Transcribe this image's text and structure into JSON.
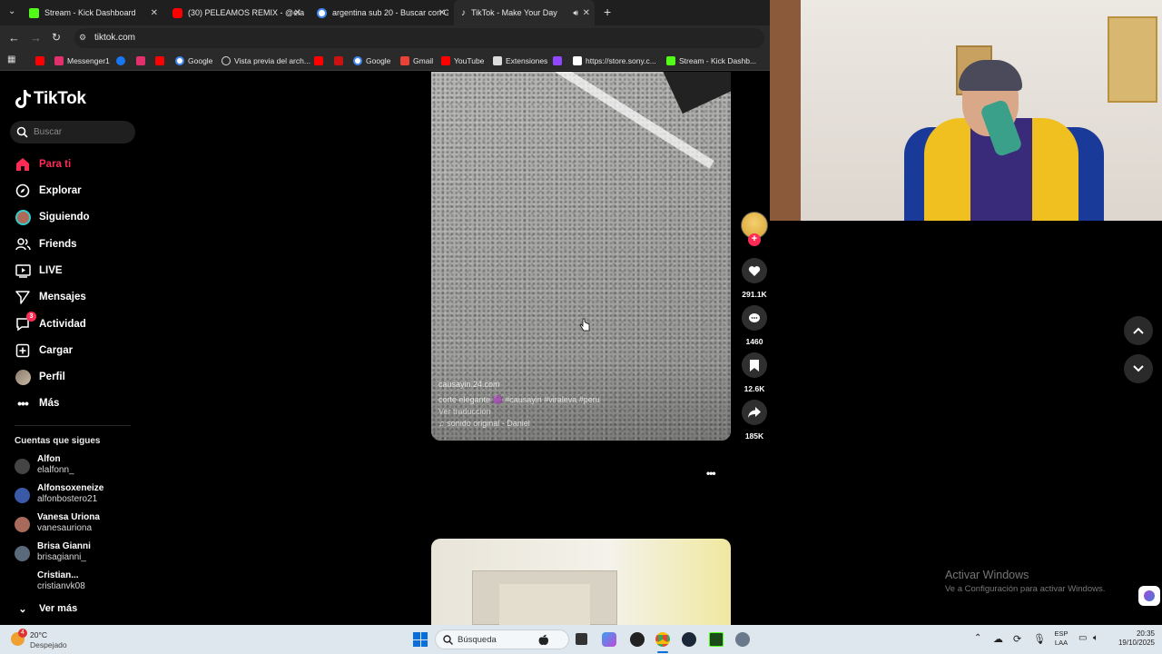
{
  "browser": {
    "tabs": [
      {
        "label": "Stream - Kick Dashboard",
        "favicon_color": "#53fc18"
      },
      {
        "label": "(30) PELEAMOS REMIX - @elag",
        "favicon_color": "#ff0000"
      },
      {
        "label": "argentina sub 20 - Buscar con G",
        "favicon_color": "#4285f4"
      },
      {
        "label": "TikTok - Make Your Day",
        "favicon_color": "#ffffff"
      }
    ],
    "url": "tiktok.com",
    "bookmarks": [
      {
        "label": "Messenger1",
        "color": "#e1306c"
      },
      {
        "label": "",
        "color": "#1877f2"
      },
      {
        "label": "",
        "color": "#e1306c"
      },
      {
        "label": "",
        "color": "#ff0000"
      },
      {
        "label": "Google",
        "color": "#4285f4"
      },
      {
        "label": "Vista previa del arch...",
        "color": "#ffffff"
      },
      {
        "label": "",
        "color": "#ff0000"
      },
      {
        "label": "",
        "color": "#d11"
      },
      {
        "label": "Google",
        "color": "#4285f4"
      },
      {
        "label": "Gmail",
        "color": "#ea4335"
      },
      {
        "label": "YouTube",
        "color": "#ff0000"
      },
      {
        "label": "Extensiones",
        "color": "#ffffff"
      },
      {
        "label": "",
        "color": "#9146ff"
      },
      {
        "label": "https://store.sony.c...",
        "color": "#ffffff"
      },
      {
        "label": "Stream - Kick Dashb...",
        "color": "#53fc18"
      }
    ]
  },
  "tiktok": {
    "logo": "TikTok",
    "search_placeholder": "Buscar",
    "nav": [
      {
        "label": "Para ti",
        "icon": "home-icon",
        "active": true
      },
      {
        "label": "Explorar",
        "icon": "compass-icon"
      },
      {
        "label": "Siguiendo",
        "icon": "following-avatar-icon"
      },
      {
        "label": "Friends",
        "icon": "friends-icon"
      },
      {
        "label": "LIVE",
        "icon": "live-icon"
      },
      {
        "label": "Mensajes",
        "icon": "messages-icon"
      },
      {
        "label": "Actividad",
        "icon": "activity-icon",
        "badge": "3"
      },
      {
        "label": "Cargar",
        "icon": "upload-icon"
      },
      {
        "label": "Perfil",
        "icon": "profile-avatar-icon"
      },
      {
        "label": "Más",
        "icon": "more-icon"
      }
    ],
    "following_heading": "Cuentas que sigues",
    "accounts": [
      {
        "name": "Alfon",
        "handle": "elalfonn_",
        "color": "#444"
      },
      {
        "name": "Alfonsoxeneize",
        "handle": "alfonbostero21",
        "color": "#3a5aa8"
      },
      {
        "name": "Vanesa Uriona",
        "handle": "vanesauriona",
        "color": "#a86a5a"
      },
      {
        "name": "Brisa Gianni",
        "handle": "brisagianni_",
        "color": "#5a6a7a"
      },
      {
        "name": "Cristian...",
        "handle": "cristianvk08",
        "color": "#000000"
      }
    ],
    "see_more": "Ver más",
    "video": {
      "watermark": "causayin.24.com",
      "caption": "corte elegante 🟣 #causayin #viraleva #peru",
      "translation": "Ver traducción",
      "sound": "♫ sonido original - Daniel"
    },
    "actions": {
      "likes": "291.1K",
      "comments": "1460",
      "saves": "12.6K",
      "shares": "185K"
    },
    "accent": "#fe2c55"
  },
  "windows": {
    "activate_title": "Activar Windows",
    "activate_sub": "Ve a Configuración para activar Windows.",
    "weather_temp": "20°C",
    "weather_desc": "Despejado",
    "weather_badge": "4",
    "search_label": "Búsqueda",
    "lang1": "ESP",
    "lang2": "LAA",
    "time": "20:35",
    "date": "19/10/2025"
  }
}
